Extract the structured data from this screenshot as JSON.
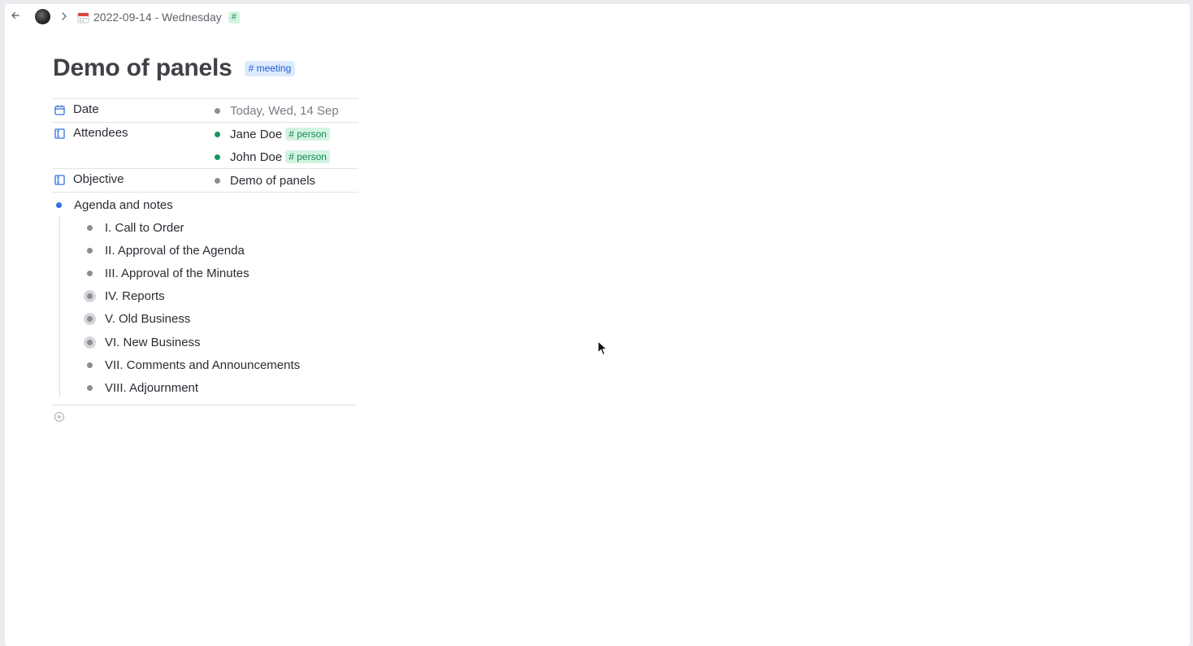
{
  "breadcrumb": {
    "back_icon": "arrow-left-icon",
    "avatar": "workspace-avatar",
    "separator_icon": "chevron-right-icon",
    "page_emoji": "calendar-icon",
    "page_label": "2022-09-14 - Wednesday",
    "tag_label": "#"
  },
  "page": {
    "title": "Demo of panels",
    "tag": "# meeting"
  },
  "fields": {
    "date": {
      "label": "Date",
      "icon": "calendar-icon",
      "value": "Today, Wed, 14 Sep"
    },
    "attendees": {
      "label": "Attendees",
      "icon": "field-icon",
      "values": [
        {
          "name": "Jane Doe",
          "tag": "# person"
        },
        {
          "name": "John Doe",
          "tag": "# person"
        }
      ]
    },
    "objective": {
      "label": "Objective",
      "icon": "field-icon",
      "value": "Demo of panels"
    }
  },
  "agenda": {
    "label": "Agenda and notes",
    "items": [
      {
        "label": "I. Call to Order",
        "collapsed": false
      },
      {
        "label": "II. Approval of the Agenda",
        "collapsed": false
      },
      {
        "label": "III. Approval of the Minutes",
        "collapsed": false
      },
      {
        "label": "IV. Reports",
        "collapsed": true
      },
      {
        "label": "V. Old Business",
        "collapsed": true
      },
      {
        "label": "VI. New Business",
        "collapsed": true
      },
      {
        "label": "VII. Comments and Announcements",
        "collapsed": false
      },
      {
        "label": "VIII. Adjournment",
        "collapsed": false
      }
    ]
  },
  "colors": {
    "accent_blue": "#2f72df",
    "tag_green_bg": "#d4f3e2",
    "tag_green_fg": "#148a4e",
    "tag_blue_bg": "#dde9fc",
    "tag_blue_fg": "#2260d6"
  }
}
